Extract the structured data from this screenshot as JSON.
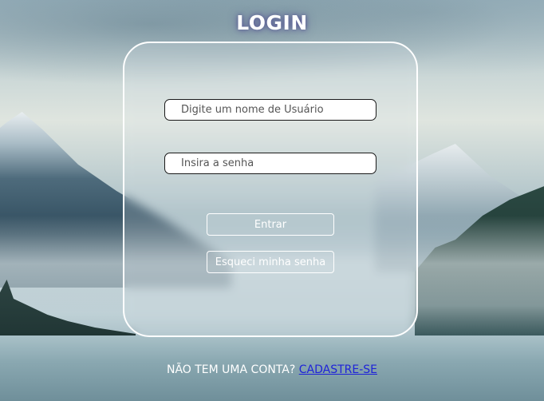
{
  "page": {
    "title": "LOGIN"
  },
  "form": {
    "username_placeholder": "Digite um nome de Usuário",
    "username_value": "",
    "password_placeholder": "Insira a senha",
    "password_value": "",
    "submit_label": "Entrar",
    "forgot_label": "Esqueci minha senha"
  },
  "footer": {
    "prompt": "NÃO TEM UMA CONTA? ",
    "signup_link": "CADASTRE-SE"
  },
  "colors": {
    "title_glow": "#463c8c",
    "link": "#1f23d8",
    "panel_border": "#ffffff"
  }
}
